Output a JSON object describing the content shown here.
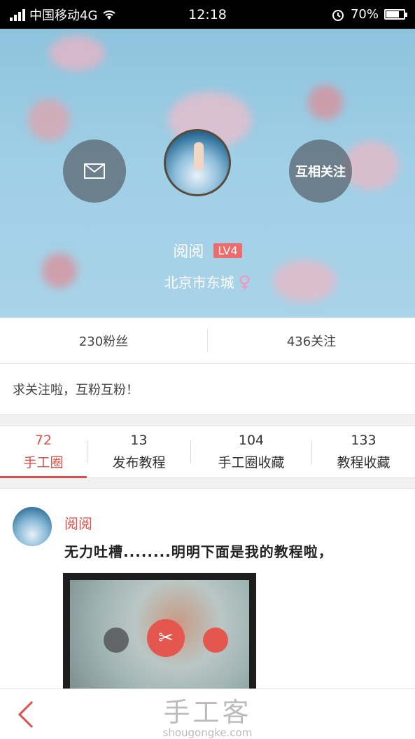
{
  "status_bar": {
    "carrier": "中国移动4G",
    "time": "12:18",
    "battery": "70%",
    "battery_level": 0.7
  },
  "profile": {
    "message_icon": "envelope-icon",
    "mutual_follow_label": "互相关注",
    "username": "阅阅",
    "level": "LV4",
    "location": "北京市东城",
    "gender_icon": "♀"
  },
  "stats": {
    "fans": "230粉丝",
    "following": "436关注"
  },
  "bio": "求关注啦，互粉互粉！",
  "tabs": [
    {
      "count": "72",
      "label": "手工圈"
    },
    {
      "count": "13",
      "label": "发布教程"
    },
    {
      "count": "104",
      "label": "手工圈收藏"
    },
    {
      "count": "133",
      "label": "教程收藏"
    }
  ],
  "post": {
    "author": "阅阅",
    "text": "无力吐槽........明明下面是我的教程啦，"
  },
  "bottom": {
    "back_icon": "chevron-left-icon",
    "watermark_cn": "手工客",
    "watermark_url": "shougongke.com"
  },
  "colors": {
    "accent": "#e0504a",
    "level_badge": "#ef6b6b",
    "header_bg": "#9fcfe6"
  }
}
